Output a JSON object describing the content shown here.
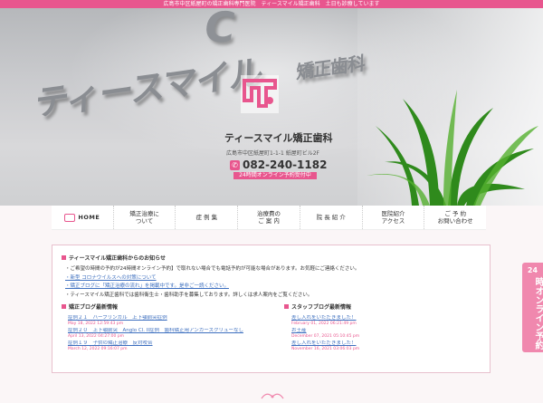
{
  "topbar": {
    "text": "広島市中区紙屋町の矯正歯科専門医院　ティースマイル矯正歯科　土日も診療しています"
  },
  "hero": {
    "big_letter": "C",
    "sign_text": "ティースマイル",
    "sign_tail": "矯正歯科",
    "clinic_name": "ティースマイル矯正歯科",
    "address": "広島市中区紙屋町1-1-1 紙屋町ビル2F",
    "phone": "082-240-1182",
    "booking_label": "24時間オンライン予約受付中",
    "icon": "phone-icon",
    "accent_color": "#e8568e"
  },
  "nav": {
    "items": [
      {
        "label": "HOME",
        "icon": "home-icon"
      },
      {
        "label": "矯正治療に\nついて"
      },
      {
        "label": "症 例 集"
      },
      {
        "label": "治療費の\nご 案 内"
      },
      {
        "label": "院 長 紹 介"
      },
      {
        "label": "医院紹介\nアクセス"
      },
      {
        "label": "ご 予 約\nお問い合わせ"
      }
    ]
  },
  "notices": {
    "title": "ティースマイル矯正歯科からのお知らせ",
    "items": [
      {
        "text": "・ご希望の時間の予約が24時間オンライン予約】で取れない場合でも電話予約が可能な場合があります。お気軽にご連絡ください。",
        "link": false
      },
      {
        "text": "・新型 コロナウイルスへの対策について",
        "link": true
      },
      {
        "text": "・矯正ブログに「矯正治療の流れ」を掲載中です。是非ご一読ください。",
        "link": true
      },
      {
        "text": "・ティースマイル矯正歯科では歯科衛生士・歯科助手を募集しております。詳しくは求人案内をご覧ください。",
        "link": false
      }
    ]
  },
  "blog": {
    "title": "矯正ブログ最新情報",
    "posts": [
      {
        "title": "症例２１　ハーフリンガル　上下顎前突症例",
        "date": "May 18, 2022 12:59:43 pm"
      },
      {
        "title": "症例２０　上下顎前突　Anglo Cl. II症例　歯科矯正用アンカースクリューなし",
        "date": "April 13, 2022 04:27:00 pm"
      },
      {
        "title": "症例１９　子供の矯正治療　反対咬合",
        "date": "March 12, 2022 09:16:07 pm"
      }
    ]
  },
  "staff_blog": {
    "title": "スタッフブログ最新情報",
    "posts": [
      {
        "title": "差し入れをいただきました！",
        "date": "February 01, 2022 06:21:49 pm"
      },
      {
        "title": "お土産",
        "date": "December 07, 2021 05:10:45 pm"
      },
      {
        "title": "差し入れをいただきました！",
        "date": "November 16, 2021 03:06:03 pm"
      }
    ]
  },
  "side_tab": {
    "number": "24",
    "label": "時オンライン予約",
    "color": "#f088ae"
  }
}
